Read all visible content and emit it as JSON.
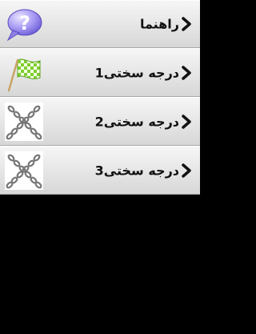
{
  "menu": {
    "items": [
      {
        "label": "راهنما",
        "icon": "help-bubble-icon"
      },
      {
        "label": "درجه سختی1",
        "icon": "checkered-flag-icon"
      },
      {
        "label": "درجه سختی2",
        "icon": "locked-chain-icon"
      },
      {
        "label": "درجه سختی3",
        "icon": "locked-chain-icon"
      }
    ],
    "chevron_icon": "chevron-right-icon"
  },
  "colors": {
    "row_top": "#f6f6f6",
    "row_bottom": "#d7d7d7",
    "background": "#000000",
    "text": "#111111"
  }
}
